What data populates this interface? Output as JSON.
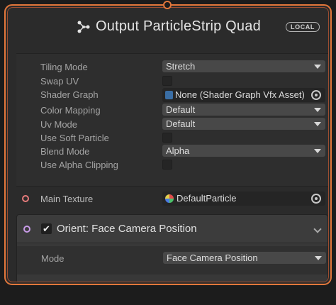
{
  "node": {
    "title": "Output ParticleStrip Quad",
    "title_icon": "particle-system-icon",
    "badge": "LOCAL",
    "colors": {
      "accent": "#e3773b",
      "port_texture": "#e67b7b",
      "port_block": "#c79ae6"
    }
  },
  "properties": [
    {
      "label": "Tiling Mode",
      "type": "dropdown",
      "value": "Stretch"
    },
    {
      "label": "Swap UV",
      "type": "checkbox",
      "checked": false
    },
    {
      "label": "Shader Graph",
      "type": "object",
      "value": "None (Shader Graph Vfx Asset)",
      "icon": "shader-graph-icon"
    },
    {
      "label": "Color Mapping",
      "type": "dropdown",
      "value": "Default"
    },
    {
      "label": "Uv Mode",
      "type": "dropdown",
      "value": "Default"
    },
    {
      "label": "Use Soft Particle",
      "type": "checkbox",
      "checked": false
    },
    {
      "label": "Blend Mode",
      "type": "dropdown",
      "value": "Alpha"
    },
    {
      "label": "Use Alpha Clipping",
      "type": "checkbox",
      "checked": false
    }
  ],
  "main_texture": {
    "label": "Main Texture",
    "value": "DefaultParticle",
    "icon": "texture-icon"
  },
  "orient_block": {
    "enabled": true,
    "check_glyph": "✔",
    "title": "Orient: Face Camera Position",
    "mode_label": "Mode",
    "mode_value": "Face Camera Position"
  }
}
